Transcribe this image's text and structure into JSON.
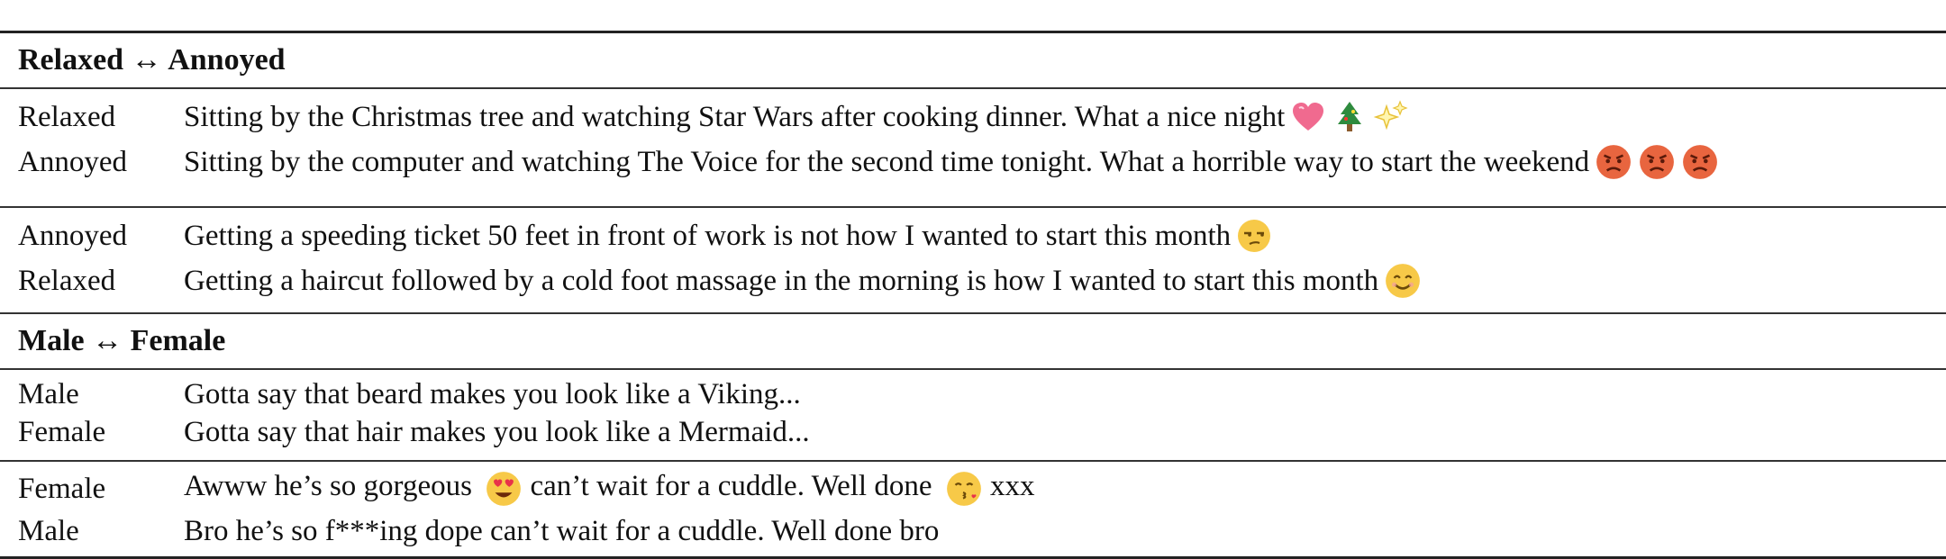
{
  "sections": [
    {
      "header": "Relaxed ↔ Annoyed",
      "groups": [
        {
          "rows": [
            {
              "label": "Relaxed",
              "text": "Sitting by the Christmas tree and watching Star Wars after cooking dinner. What a nice night",
              "emojis": [
                "heart-icon",
                "christmas-tree-icon",
                "sparkles-icon"
              ]
            },
            {
              "label": "Annoyed",
              "text": "Sitting by the computer and watching The Voice for the second time tonight. What a horrible way to start the weekend",
              "emojis": [
                "angry-face-icon",
                "angry-face-icon",
                "angry-face-icon"
              ]
            }
          ]
        },
        {
          "rows": [
            {
              "label": "Annoyed",
              "text": "Getting a speeding ticket 50 feet in front of work is not how I wanted to start this month",
              "emojis": [
                "unamused-face-icon"
              ]
            },
            {
              "label": "Relaxed",
              "text": "Getting a haircut followed by a cold foot massage in the morning is how I wanted to start this month",
              "emojis": [
                "smiling-face-icon"
              ]
            }
          ]
        }
      ]
    },
    {
      "header": "Male ↔ Female",
      "groups": [
        {
          "rows": [
            {
              "label": "Male",
              "text": "Gotta say that beard makes you look like a Viking..."
            },
            {
              "label": "Female",
              "text": "Gotta say that hair makes you look like a Mermaid..."
            }
          ]
        },
        {
          "rows": [
            {
              "label": "Female",
              "text_parts": [
                "Awww he’s so gorgeous",
                "can’t wait for a cuddle. Well done",
                "xxx"
              ],
              "emojis": [
                "heart-eyes-face-icon",
                "kissing-face-icon"
              ]
            },
            {
              "label": "Male",
              "text": "Bro he’s so f***ing dope can’t wait for a cuddle. Well done bro"
            }
          ]
        }
      ]
    }
  ]
}
